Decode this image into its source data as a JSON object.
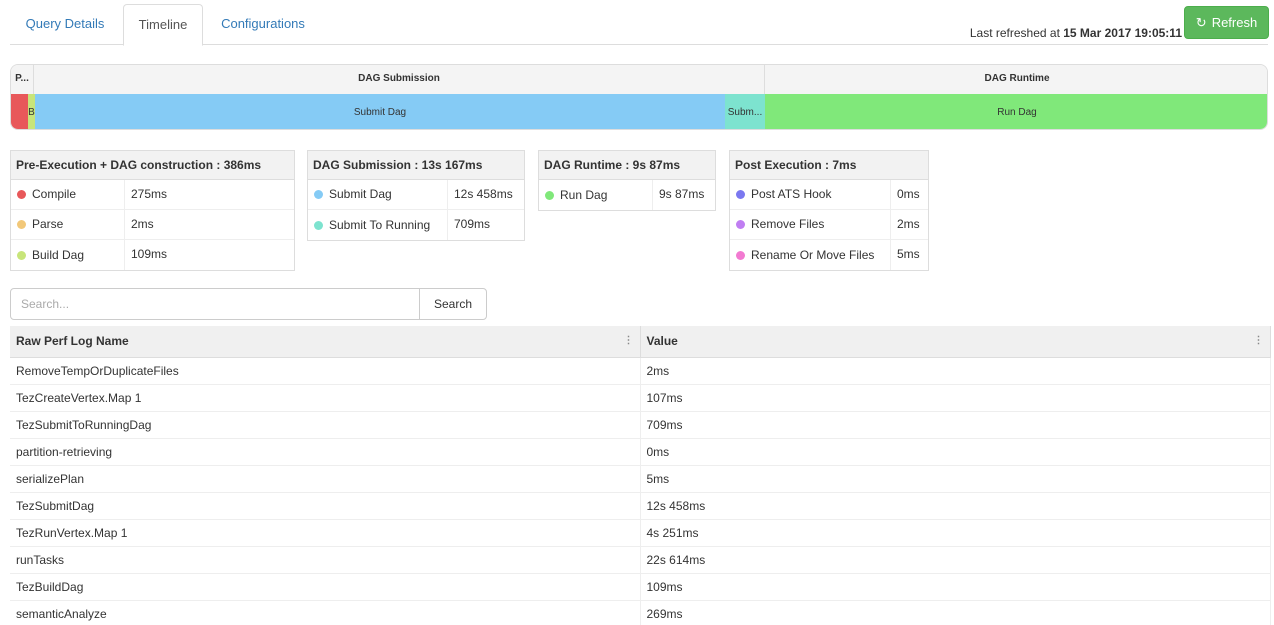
{
  "tabs": [
    {
      "label": "Query Details"
    },
    {
      "label": "Timeline"
    },
    {
      "label": "Configurations"
    }
  ],
  "refresh": {
    "prefix": "Last refreshed at ",
    "time": "15 Mar 2017 19:05:11",
    "button_label": "Refresh",
    "button_icon": "refresh-icon"
  },
  "timeline": {
    "phases": [
      {
        "label": "P..."
      },
      {
        "label": "DAG Submission"
      },
      {
        "label": "DAG Runtime"
      }
    ],
    "steps": [
      {
        "label": "",
        "color": "#e8585a"
      },
      {
        "label": "B",
        "color": "#c8e57a"
      },
      {
        "label": "Submit Dag",
        "color": "#85cbf5"
      },
      {
        "label": "Subm...",
        "color": "#7de3cf"
      },
      {
        "label": "Run Dag",
        "color": "#80e87a"
      }
    ]
  },
  "stats": [
    {
      "title": "Pre-Execution + DAG construction : 386ms",
      "rows": [
        {
          "name": "Compile",
          "value": "275ms",
          "color": "#e8585a"
        },
        {
          "name": "Parse",
          "value": "2ms",
          "color": "#f2c879"
        },
        {
          "name": "Build Dag",
          "value": "109ms",
          "color": "#c8e57a"
        }
      ]
    },
    {
      "title": "DAG Submission : 13s 167ms",
      "rows": [
        {
          "name": "Submit Dag",
          "value": "12s 458ms",
          "color": "#85cbf5"
        },
        {
          "name": "Submit To Running",
          "value": "709ms",
          "color": "#7de3cf"
        }
      ]
    },
    {
      "title": "DAG Runtime : 9s 87ms",
      "rows": [
        {
          "name": "Run Dag",
          "value": "9s 87ms",
          "color": "#80e87a"
        }
      ]
    },
    {
      "title": "Post Execution : 7ms",
      "rows": [
        {
          "name": "Post ATS Hook",
          "value": "0ms",
          "color": "#7b78f0"
        },
        {
          "name": "Remove Files",
          "value": "2ms",
          "color": "#c07ef2"
        },
        {
          "name": "Rename Or Move Files",
          "value": "5ms",
          "color": "#f27ad1"
        }
      ]
    }
  ],
  "search": {
    "placeholder": "Search...",
    "button_label": "Search"
  },
  "perf_table": {
    "headers": [
      "Raw Perf Log Name",
      "Value"
    ],
    "rows": [
      [
        "RemoveTempOrDuplicateFiles",
        "2ms"
      ],
      [
        "TezCreateVertex.Map 1",
        "107ms"
      ],
      [
        "TezSubmitToRunningDag",
        "709ms"
      ],
      [
        "partition-retrieving",
        "0ms"
      ],
      [
        "serializePlan",
        "5ms"
      ],
      [
        "TezSubmitDag",
        "12s 458ms"
      ],
      [
        "TezRunVertex.Map 1",
        "4s 251ms"
      ],
      [
        "runTasks",
        "22s 614ms"
      ],
      [
        "TezBuildDag",
        "109ms"
      ],
      [
        "semanticAnalyze",
        "269ms"
      ]
    ]
  }
}
